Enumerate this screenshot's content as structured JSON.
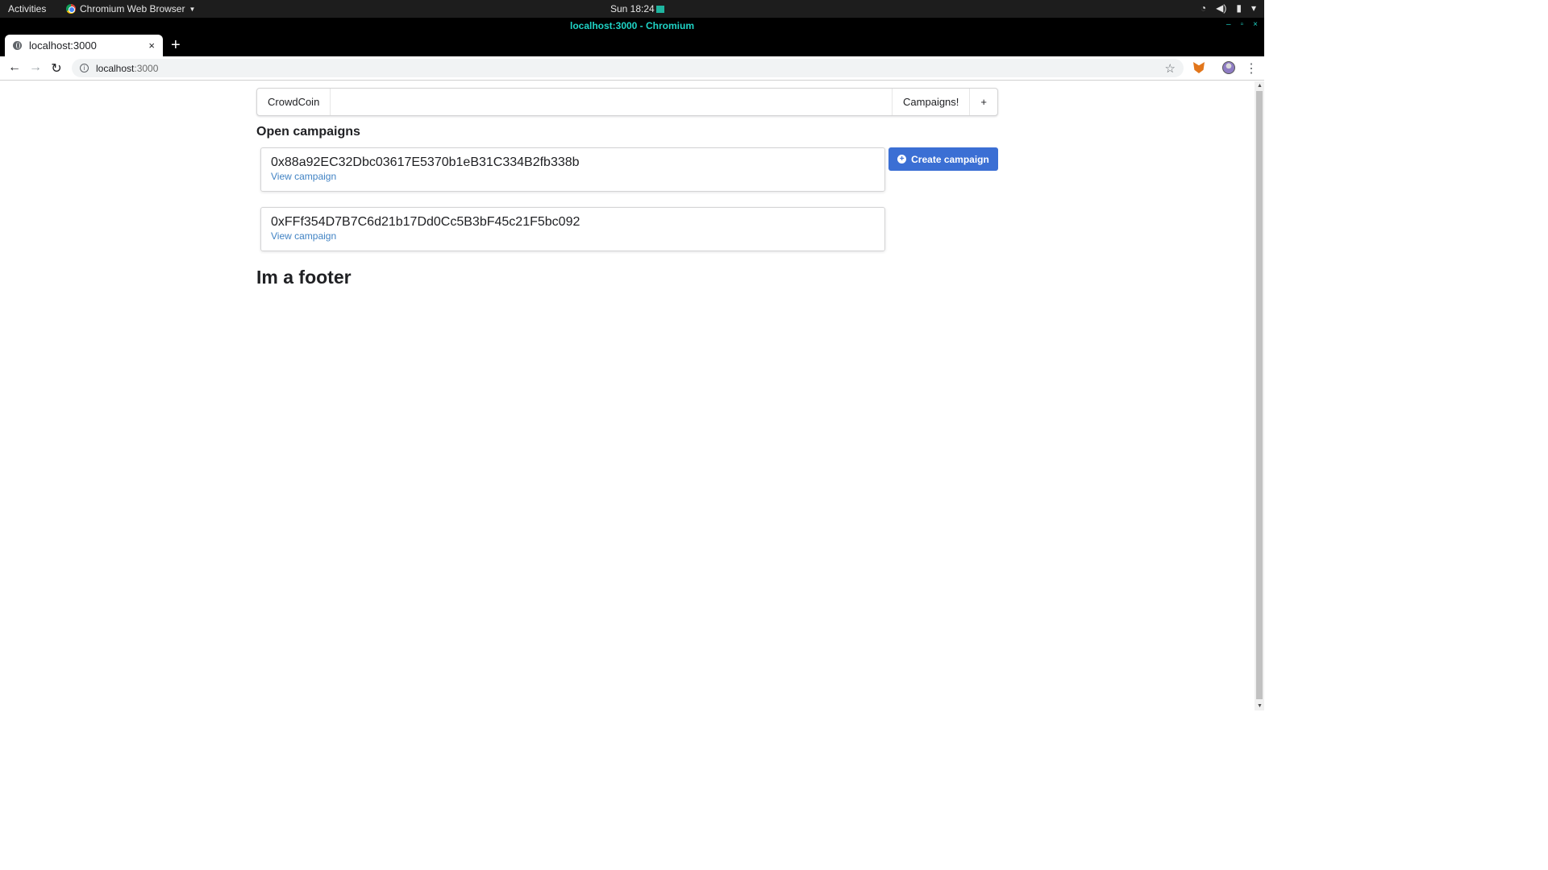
{
  "system": {
    "activities": "Activities",
    "app_menu": "Chromium Web Browser",
    "clock": "Sun 18:24",
    "icons": [
      "wifi-icon",
      "volume-icon",
      "battery-icon",
      "system-menu-icon"
    ]
  },
  "browser": {
    "window_title": "localhost:3000 - Chromium",
    "window_controls": [
      "–",
      "▫",
      "×"
    ],
    "tab": {
      "title": "localhost:3000",
      "close": "×"
    },
    "new_tab": "+",
    "url_host": "localhost",
    "url_port": ":3000"
  },
  "page": {
    "menu": {
      "brand": "CrowdCoin",
      "campaigns": "Campaigns!",
      "plus": "+"
    },
    "section_title": "Open campaigns",
    "campaigns": [
      {
        "address": "0x88a92EC32Dbc03617E5370b1eB31C334B2fb338b",
        "link": "View campaign"
      },
      {
        "address": "0xFFf354D7B7C6d21b17Dd0Cc5B3bF45c21F5bc092",
        "link": "View campaign"
      }
    ],
    "create_button": "Create campaign",
    "footer": "Im a footer"
  },
  "colors": {
    "primary_button": "#3b6fd4",
    "link": "#4183c4",
    "title_accent": "#1fd4c6"
  }
}
